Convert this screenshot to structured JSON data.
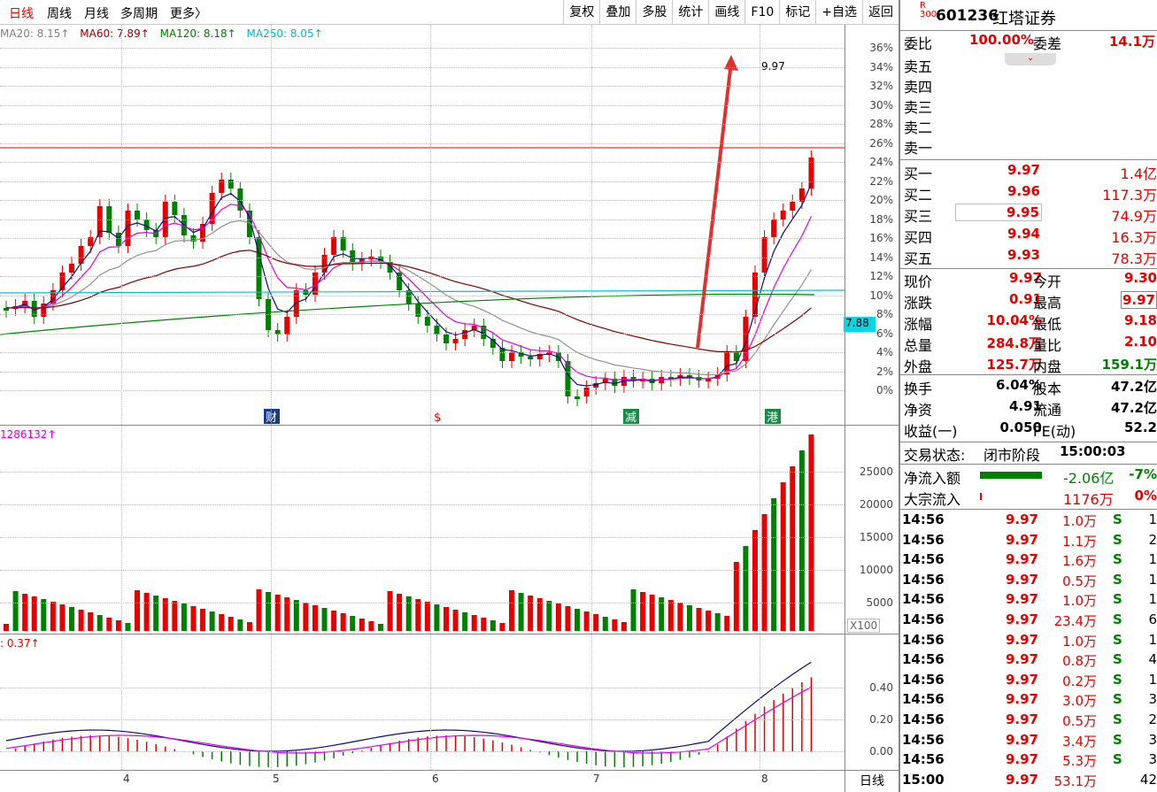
{
  "periods": {
    "day": "日线",
    "week": "周线",
    "month": "月线",
    "multi": "多周期",
    "more": "更多〉"
  },
  "toolbar": [
    "复权",
    "叠加",
    "多股",
    "统计",
    "画线",
    "F10",
    "标记",
    "+自选",
    "返回"
  ],
  "ma_legend": [
    {
      "text": "MA20: 8.15↑",
      "color": "#808080"
    },
    {
      "text": "MA60: 7.89↑",
      "color": "#800000"
    },
    {
      "text": "MA120: 8.18↑",
      "color": "#008000"
    },
    {
      "text": "MA250: 8.05↑",
      "color": "#00b0c0"
    }
  ],
  "price_axis": [
    "36%",
    "34%",
    "32%",
    "30%",
    "28%",
    "26%",
    "24%",
    "22%",
    "20%",
    "18%",
    "16%",
    "14%",
    "12%",
    "10%",
    "8%",
    "6%",
    "4%",
    "2%",
    "0%"
  ],
  "current_price_tag": "7.88",
  "high_marker": "9.97",
  "event_marks": [
    "财",
    "$",
    "减",
    "港"
  ],
  "months": [
    "4",
    "5",
    "6",
    "7",
    "8"
  ],
  "volume_legend": "1286132↑",
  "volume_axis": [
    "25000",
    "20000",
    "15000",
    "10000",
    "5000"
  ],
  "volume_unit": "X100",
  "macd_legend": ": 0.37↑",
  "macd_axis": [
    "0.40",
    "0.20",
    "0.00"
  ],
  "period_tab": "日线",
  "quote": {
    "stock_code": "601236",
    "stock_name": "红塔证券",
    "board_badge": "R",
    "board_sub": "300",
    "ratio_label": "委比",
    "ratio_value": "100.00%",
    "diff_label": "委差",
    "diff_value": "14.1万",
    "sell": [
      {
        "label": "卖五"
      },
      {
        "label": "卖四"
      },
      {
        "label": "卖三"
      },
      {
        "label": "卖二"
      },
      {
        "label": "卖一"
      }
    ],
    "buy": [
      {
        "label": "买一",
        "price": "9.97",
        "vol": "1.4亿"
      },
      {
        "label": "买二",
        "price": "9.96",
        "vol": "117.3万"
      },
      {
        "label": "买三",
        "price": "9.95",
        "vol": "74.9万"
      },
      {
        "label": "买四",
        "price": "9.94",
        "vol": "16.3万"
      },
      {
        "label": "买五",
        "price": "9.93",
        "vol": "78.3万"
      }
    ],
    "stats": [
      {
        "l1": "现价",
        "v1": "9.97",
        "l2": "今开",
        "v2": "9.30"
      },
      {
        "l1": "涨跌",
        "v1": "0.91",
        "l2": "最高",
        "v2": "9.97"
      },
      {
        "l1": "涨幅",
        "v1": "10.04%",
        "l2": "最低",
        "v2": "9.18"
      },
      {
        "l1": "总量",
        "v1": "284.8万",
        "l2": "量比",
        "v2": "2.10"
      },
      {
        "l1": "外盘",
        "v1": "125.7万",
        "l2": "内盘",
        "v2": "159.1万"
      }
    ],
    "fund": [
      {
        "l1": "换手",
        "v1": "6.04%",
        "l2": "股本",
        "v2": "47.2亿"
      },
      {
        "l1": "净资",
        "v1": "4.91",
        "l2": "流通",
        "v2": "47.2亿"
      },
      {
        "l1": "收益(一)",
        "v1": "0.050",
        "l2": "PE(动)",
        "v2": "52.2"
      }
    ],
    "status_label": "交易状态:",
    "status_value": "闭市阶段",
    "status_time": "15:00:03",
    "netflow_label": "净流入额",
    "netflow_value": "-2.06亿",
    "netflow_pct": "-7%",
    "block_label": "大宗流入",
    "block_value": "1176万",
    "block_pct": "0%",
    "ticks": [
      {
        "t": "14:56",
        "p": "9.97",
        "v": "1.0万",
        "s": "S",
        "n": "1"
      },
      {
        "t": "14:56",
        "p": "9.97",
        "v": "1.1万",
        "s": "S",
        "n": "2"
      },
      {
        "t": "14:56",
        "p": "9.97",
        "v": "1.6万",
        "s": "S",
        "n": "1"
      },
      {
        "t": "14:56",
        "p": "9.97",
        "v": "0.5万",
        "s": "S",
        "n": "1"
      },
      {
        "t": "14:56",
        "p": "9.97",
        "v": "1.0万",
        "s": "S",
        "n": "1"
      },
      {
        "t": "14:56",
        "p": "9.97",
        "v": "23.4万",
        "s": "S",
        "n": "6"
      },
      {
        "t": "14:56",
        "p": "9.97",
        "v": "1.0万",
        "s": "S",
        "n": "1"
      },
      {
        "t": "14:56",
        "p": "9.97",
        "v": "0.8万",
        "s": "S",
        "n": "4"
      },
      {
        "t": "14:56",
        "p": "9.97",
        "v": "0.2万",
        "s": "S",
        "n": "1"
      },
      {
        "t": "14:56",
        "p": "9.97",
        "v": "3.0万",
        "s": "S",
        "n": "3"
      },
      {
        "t": "14:56",
        "p": "9.97",
        "v": "0.5万",
        "s": "S",
        "n": "2"
      },
      {
        "t": "14:56",
        "p": "9.97",
        "v": "3.4万",
        "s": "S",
        "n": "3"
      },
      {
        "t": "14:56",
        "p": "9.97",
        "v": "5.3万",
        "s": "S",
        "n": "3"
      },
      {
        "t": "15:00",
        "p": "9.97",
        "v": "53.1万",
        "s": "",
        "n": "42"
      }
    ]
  }
}
